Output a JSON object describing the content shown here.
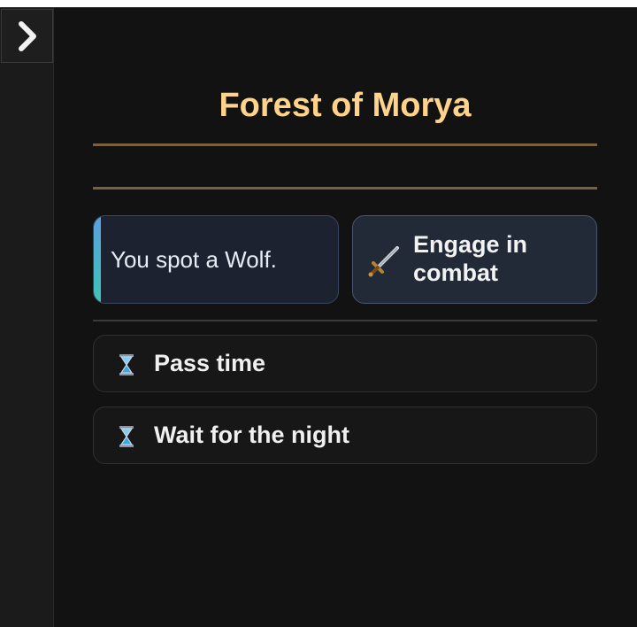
{
  "location": {
    "title": "Forest of Morya"
  },
  "encounter": {
    "message": "You spot a Wolf."
  },
  "combat": {
    "label": "Engage in combat",
    "icon": "sword-icon"
  },
  "actions": [
    {
      "label": "Pass time",
      "icon": "hourglass-icon"
    },
    {
      "label": "Wait for the night",
      "icon": "hourglass-icon"
    }
  ],
  "colors": {
    "title": "#ffd38a",
    "rule": "#7a6040",
    "accent_top": "#5aa0e0",
    "accent_bottom": "#3ec4b4"
  }
}
